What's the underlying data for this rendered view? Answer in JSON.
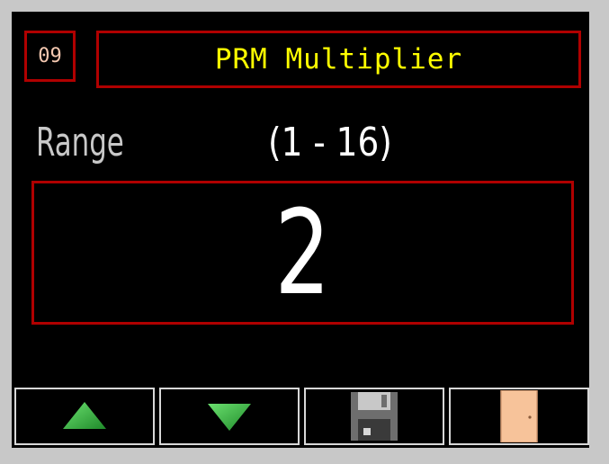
{
  "header": {
    "code": "09",
    "title": "PRM Multiplier"
  },
  "range": {
    "label": "Range",
    "value": "(1 - 16)"
  },
  "current_value": "2",
  "buttons": [
    {
      "name": "increase-button",
      "icon": "arrow-up-icon"
    },
    {
      "name": "decrease-button",
      "icon": "arrow-down-icon"
    },
    {
      "name": "save-button",
      "icon": "floppy-disk-icon"
    },
    {
      "name": "exit-button",
      "icon": "door-icon"
    }
  ],
  "colors": {
    "screen_bg": "#000000",
    "border_red": "#b00000",
    "title_yellow": "#ffff00",
    "code_text": "#f4c8b0",
    "arrow_green": "#2eaa3a",
    "door_peach": "#f7c39a",
    "floppy_gray": "#7a7a7a"
  }
}
